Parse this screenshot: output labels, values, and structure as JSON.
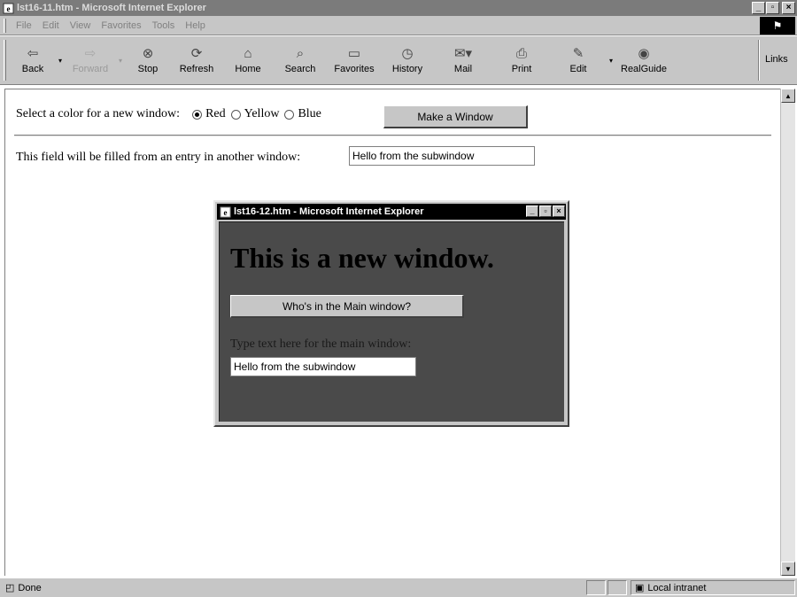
{
  "window": {
    "title": "lst16-11.htm - Microsoft Internet Explorer",
    "controls": {
      "minimize": "_",
      "maximize": "▫",
      "close": "×"
    }
  },
  "menu": [
    "File",
    "Edit",
    "View",
    "Favorites",
    "Tools",
    "Help"
  ],
  "toolbar": {
    "back": "Back",
    "forward": "Forward",
    "stop": "Stop",
    "refresh": "Refresh",
    "home": "Home",
    "search": "Search",
    "favorites": "Favorites",
    "history": "History",
    "mail": "Mail",
    "print": "Print",
    "edit": "Edit",
    "realguide": "RealGuide",
    "links": "Links"
  },
  "page": {
    "color_prompt": "Select a color for a new window:",
    "colors": [
      {
        "label": "Red",
        "selected": true
      },
      {
        "label": "Yellow",
        "selected": false
      },
      {
        "label": "Blue",
        "selected": false
      }
    ],
    "make_window_button": "Make a Window",
    "field_label": "This field will be filled from an entry in another window:",
    "field_value": "Hello from the subwindow"
  },
  "subwindow": {
    "title": "lst16-12.htm - Microsoft Internet Explorer",
    "heading": "This is a new window.",
    "who_button": "Who's in the Main window?",
    "text_label": "Type text here for the main window:",
    "text_value": "Hello from the subwindow",
    "body_color": "#4a4a4a"
  },
  "status": {
    "text": "Done",
    "zone": "Local intranet"
  }
}
